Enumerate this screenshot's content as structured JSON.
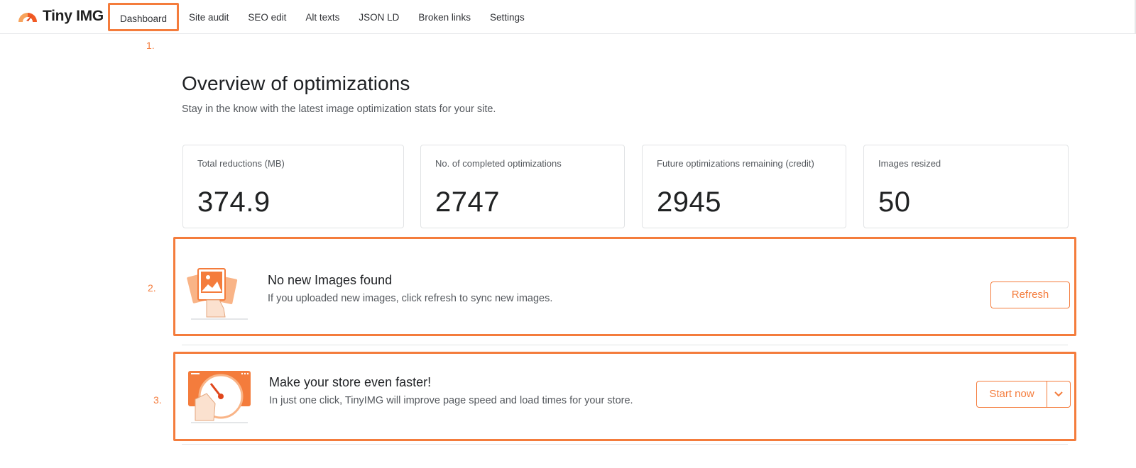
{
  "brand": {
    "name": "Tiny IMG"
  },
  "nav": {
    "items": [
      {
        "label": "Dashboard",
        "active": true
      },
      {
        "label": "Site audit"
      },
      {
        "label": "SEO edit"
      },
      {
        "label": "Alt texts"
      },
      {
        "label": "JSON LD"
      },
      {
        "label": "Broken links"
      },
      {
        "label": "Settings"
      }
    ]
  },
  "annotations": {
    "one": "1.",
    "two": "2.",
    "three": "3."
  },
  "page": {
    "title": "Overview of optimizations",
    "subtitle": "Stay in the know with the latest image optimization stats for your site."
  },
  "stats": [
    {
      "label": "Total reductions (MB)",
      "value": "374.9"
    },
    {
      "label": "No. of completed optimizations",
      "value": "2747"
    },
    {
      "label": "Future optimizations remaining (credit)",
      "value": "2945"
    },
    {
      "label": "Images resized",
      "value": "50"
    }
  ],
  "banner_images": {
    "title": "No new Images found",
    "text": "If you uploaded new images, click refresh to sync new images.",
    "button": "Refresh"
  },
  "banner_speed": {
    "title": "Make your store even faster!",
    "text": "In just one click, TinyIMG will improve page speed and load times for your store.",
    "button": "Start now"
  },
  "colors": {
    "accent": "#f47c3c",
    "text": "#202223",
    "muted": "#54585d",
    "border": "#e1e3e5"
  },
  "icons": {
    "logo": "tinyimg-logo-icon",
    "images": "images-stack-icon",
    "speed": "speedometer-icon",
    "dropdown": "chevron-down-icon"
  }
}
